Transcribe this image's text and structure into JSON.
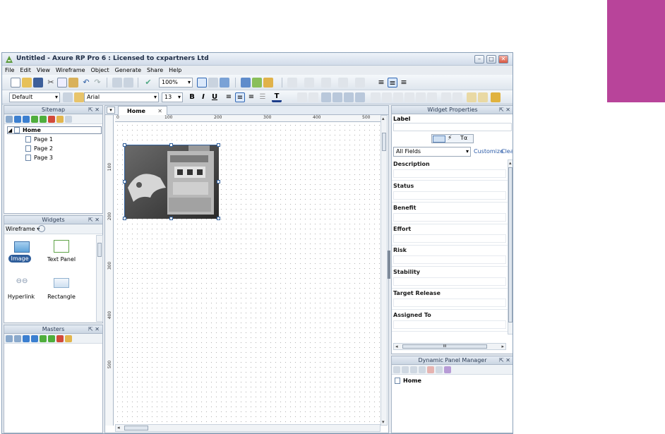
{
  "app": {
    "title": "Untitled - Axure RP Pro 6 : Licensed to cxpartners Ltd",
    "menu": [
      "File",
      "Edit",
      "View",
      "Wireframe",
      "Object",
      "Generate",
      "Share",
      "Help"
    ],
    "window_buttons": [
      "–",
      "□",
      "✕"
    ]
  },
  "toolbar1": {
    "zoom": "100%"
  },
  "toolbar2": {
    "style": "Default",
    "font": "Arial",
    "size": "13",
    "bold": "B",
    "italic": "I",
    "underline": "U",
    "text_color": "T"
  },
  "sitemap": {
    "title": "Sitemap",
    "controls": "⇱ ✕",
    "root": "Home",
    "pages": [
      "Page 1",
      "Page 2",
      "Page 3"
    ]
  },
  "widgets": {
    "title": "Widgets",
    "controls": "⇱ ✕",
    "library": "Wireframe",
    "items": [
      "Image",
      "Text Panel",
      "Hyperlink",
      "Rectangle"
    ]
  },
  "masters": {
    "title": "Masters",
    "controls": "⇱ ✕"
  },
  "canvas": {
    "tab": "Home",
    "tab_close": "✕",
    "ruler_top": [
      "0",
      "100",
      "200",
      "300",
      "400",
      "500"
    ],
    "ruler_left": [
      "100",
      "200",
      "300",
      "400",
      "500"
    ]
  },
  "widget_properties": {
    "title": "Widget Properties",
    "controls": "⇱ ✕",
    "label": "Label",
    "field_filter": "All Fields",
    "customize": "Customize",
    "clear": "Clear",
    "fields": [
      "Description",
      "Status",
      "Benefit",
      "Effort",
      "Risk",
      "Stability",
      "Target Release",
      "Assigned To"
    ],
    "hscroll": "III"
  },
  "dynamic_panel_manager": {
    "title": "Dynamic Panel Manager",
    "controls": "⇱ ✕",
    "root": "Home"
  }
}
